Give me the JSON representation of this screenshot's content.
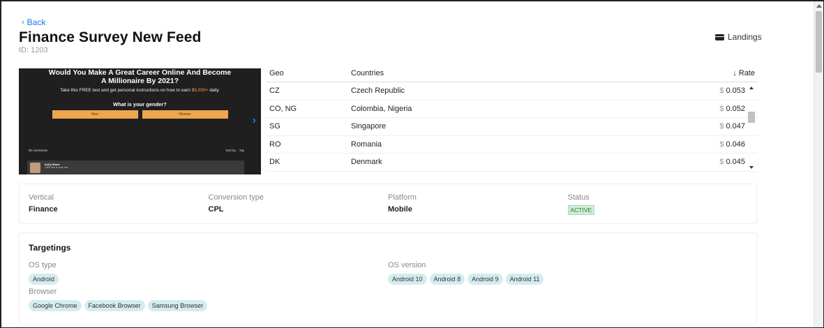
{
  "header": {
    "back_label": "Back",
    "title": "Finance Survey New Feed",
    "id_text": "ID: 1203",
    "landings_label": "Landings"
  },
  "preview": {
    "headline": "Would You Make A Great Career Online And Become A Millionaire By 2021?",
    "subtitle_prefix": "Take this FREE test and get personal instructions on how to earn",
    "subtitle_money": "$5,000+",
    "subtitle_suffix": "daily.",
    "question": "What is your gender?",
    "option_1": "Man",
    "option_2": "Woman",
    "comments_count": "80 comments",
    "sort_label": "Sort by:",
    "sort_value": "Top",
    "commenter_name": "Kelly Stone",
    "comment_text": "OMG this is sooo true"
  },
  "geo_table": {
    "headers": {
      "geo": "Geo",
      "countries": "Countries",
      "rate": "Rate"
    },
    "currency": "$",
    "rows": [
      {
        "geo": "CZ",
        "countries": "Czech Republic",
        "rate": "0.053"
      },
      {
        "geo": "CO, NG",
        "countries": "Colombia, Nigeria",
        "rate": "0.052"
      },
      {
        "geo": "SG",
        "countries": "Singapore",
        "rate": "0.047"
      },
      {
        "geo": "RO",
        "countries": "Romania",
        "rate": "0.046"
      },
      {
        "geo": "DK",
        "countries": "Denmark",
        "rate": "0.045"
      }
    ]
  },
  "info": {
    "vertical_label": "Vertical",
    "vertical_value": "Finance",
    "conversion_label": "Conversion type",
    "conversion_value": "CPL",
    "platform_label": "Platform",
    "platform_value": "Mobile",
    "status_label": "Status",
    "status_value": "ACTIVE"
  },
  "targetings": {
    "title": "Targetings",
    "os_type_label": "OS type",
    "os_types": [
      "Android"
    ],
    "os_version_label": "OS version",
    "os_versions": [
      "Android 10",
      "Android 8",
      "Android 9",
      "Android 11"
    ],
    "browser_label": "Browser",
    "browsers": [
      "Google Chrome",
      "Facebook Browser",
      "Samsung Browser"
    ]
  },
  "colors": {
    "link": "#1a73e8",
    "chip": "#d4ecef",
    "active_badge": "#cfeed5",
    "cta": "#f0a64b"
  }
}
